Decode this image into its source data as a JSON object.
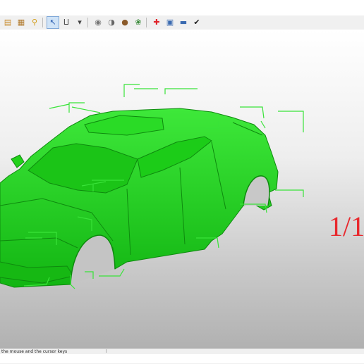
{
  "toolbar": {
    "buttons": [
      {
        "name": "new-file-icon",
        "glyph": "▤",
        "color": "#c98a2b"
      },
      {
        "name": "open-file-icon",
        "glyph": "▦",
        "color": "#b0782a"
      },
      {
        "name": "zoom-icon",
        "glyph": "⚲",
        "color": "#d29a10"
      },
      {
        "name": "select-cursor-icon",
        "glyph": "↖",
        "color": "#2a5db0",
        "selected": true
      },
      {
        "name": "axes-icon",
        "glyph": "⨿",
        "color": "#444444"
      },
      {
        "name": "view-dropdown-icon",
        "glyph": "▾",
        "color": "#444444"
      },
      {
        "name": "render-icon",
        "glyph": "◉",
        "color": "#777777"
      },
      {
        "name": "shading-icon",
        "glyph": "◑",
        "color": "#666666"
      },
      {
        "name": "sphere-icon",
        "glyph": "●",
        "color": "#8a5a2a"
      },
      {
        "name": "material-icon",
        "glyph": "❀",
        "color": "#3a8a3a"
      },
      {
        "name": "add-icon",
        "glyph": "✚",
        "color": "#e0232a"
      },
      {
        "name": "measure-icon",
        "glyph": "▣",
        "color": "#3a6ab0"
      },
      {
        "name": "minus-bar-icon",
        "glyph": "▬",
        "color": "#3a6ab0"
      },
      {
        "name": "check-icon",
        "glyph": "✔",
        "color": "#222222"
      }
    ]
  },
  "viewport": {
    "scale_label": "1/1",
    "model_color": "#22d11a",
    "bbox_color": "#39e339"
  },
  "statusbar": {
    "hint": "the mouse and the cursor keys"
  }
}
